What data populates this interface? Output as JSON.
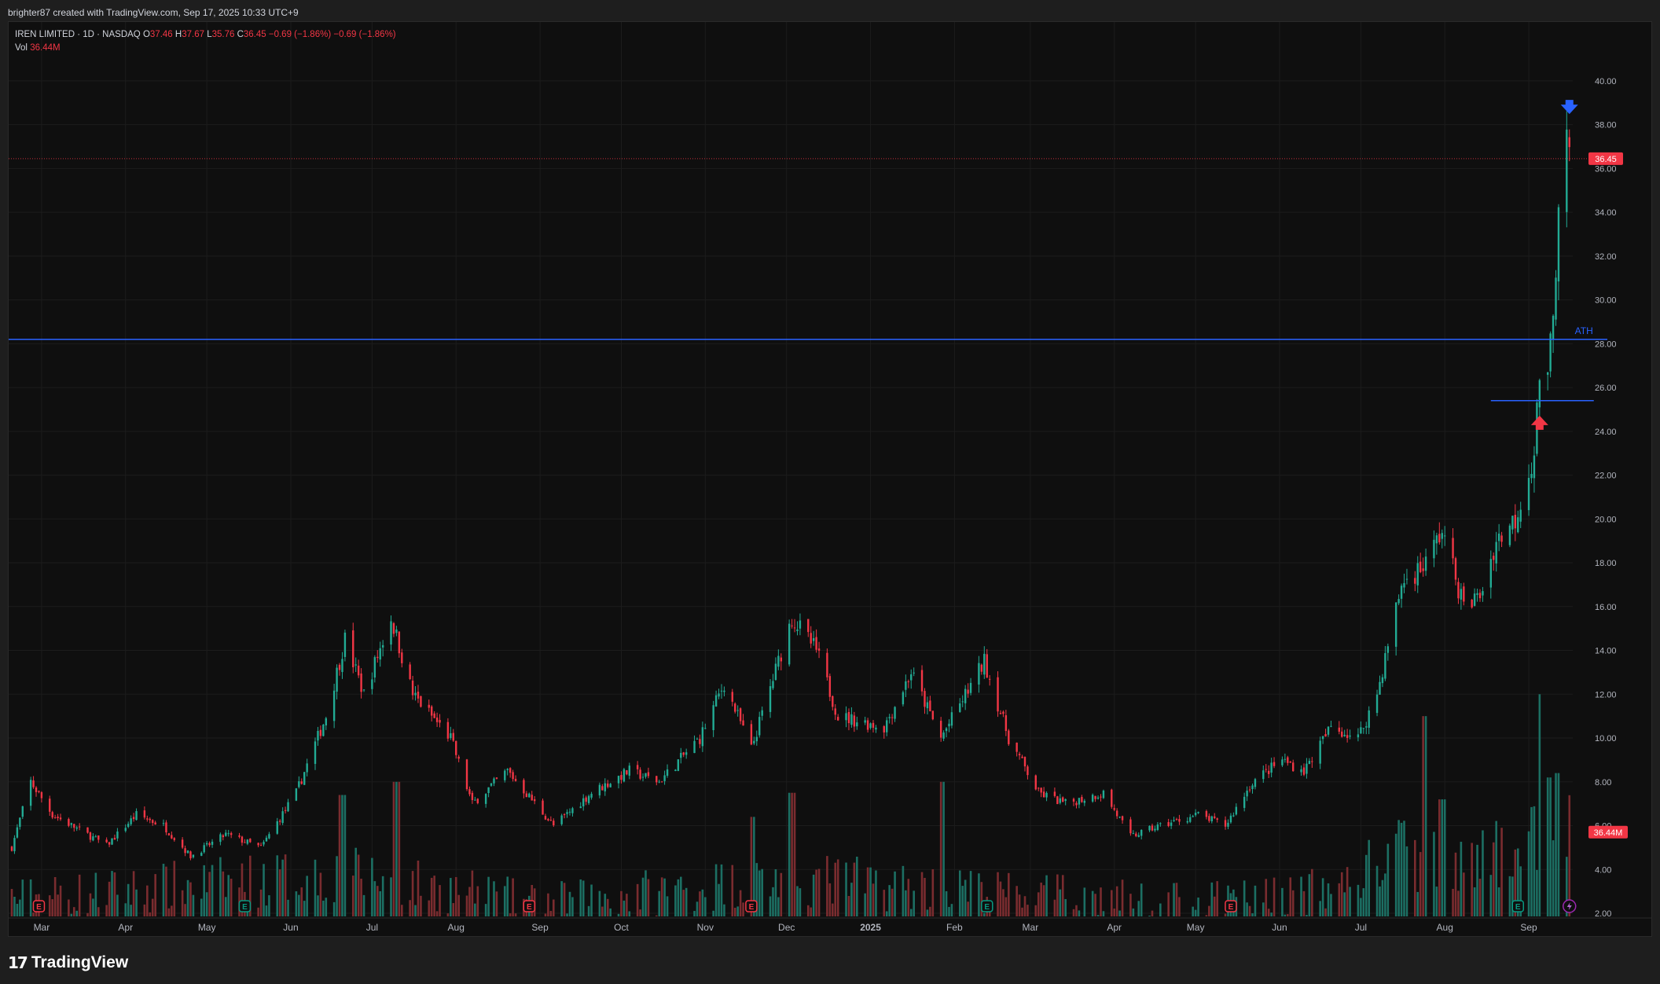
{
  "header": {
    "caption": "brighter87 created with TradingView.com, Sep 17, 2025 10:33 UTC+9"
  },
  "legend": {
    "symbol": "IREN LIMITED · 1D · NASDAQ",
    "o_label": "O",
    "o": "37.46",
    "h_label": "H",
    "h": "37.67",
    "l_label": "L",
    "l": "35.76",
    "c_label": "C",
    "c": "36.45",
    "change": "−0.69 (−1.86%)",
    "change2": "−0.69 (−1.86%)",
    "vol_label": "Vol",
    "vol": "36.44M"
  },
  "footer": {
    "logo_mark": "17",
    "logo_text": "TradingView"
  },
  "colors": {
    "up": "#22ab94",
    "down": "#f23645",
    "up_vol": "#1c6f63",
    "down_vol": "#7a2c2f",
    "level": "#2962ff",
    "grid": "#1c1c1c",
    "axis_text": "#b2b5be",
    "bg": "#0f0f0f",
    "arrow_down": "#2962ff",
    "arrow_up": "#f23645",
    "earnings": "#f23645",
    "earnings_green": "#089981"
  },
  "chart_data": {
    "type": "candlestick",
    "interval": "1D",
    "ylim": [
      2,
      41
    ],
    "y_ticks": [
      "40.00",
      "38.00",
      "36.00",
      "34.00",
      "32.00",
      "30.00",
      "28.00",
      "26.00",
      "24.00",
      "22.00",
      "20.00",
      "18.00",
      "16.00",
      "14.00",
      "12.00",
      "10.00",
      "8.00",
      "6.00",
      "4.00",
      "2.00"
    ],
    "x_ticks": [
      "Mar",
      "Apr",
      "May",
      "Jun",
      "Jul",
      "Aug",
      "Sep",
      "Oct",
      "Nov",
      "Dec",
      "2025",
      "Feb",
      "Mar",
      "Apr",
      "May",
      "Jun",
      "Jul",
      "Aug",
      "Sep"
    ],
    "x_range": [
      "2024-02-19",
      "2025-09-30"
    ],
    "last_price": {
      "value": 36.45,
      "label": "36.45"
    },
    "last_volume": {
      "value": 6.6,
      "label": "36.44M"
    },
    "ath_level": {
      "value": 28.2,
      "label": "ATH"
    },
    "support_level": {
      "value": 25.4,
      "from": "2025-08-18",
      "to": "2025-09-25"
    },
    "markers": [
      {
        "type": "arrow-down",
        "date": "2025-09-16",
        "price": 38.7
      },
      {
        "type": "arrow-up",
        "date": "2025-09-05",
        "price": 24.5
      }
    ],
    "earnings": [
      {
        "date": "2024-02-29",
        "label": "E",
        "color": "red"
      },
      {
        "date": "2024-05-15",
        "label": "E",
        "color": "green"
      },
      {
        "date": "2024-08-28",
        "label": "E",
        "color": "red"
      },
      {
        "date": "2024-11-18",
        "label": "E",
        "color": "red"
      },
      {
        "date": "2025-02-13",
        "label": "E",
        "color": "green"
      },
      {
        "date": "2025-05-14",
        "label": "E",
        "color": "red"
      },
      {
        "date": "2025-08-28",
        "label": "E",
        "color": "green"
      }
    ],
    "price_path": [
      [
        "2024-02-19",
        5.0
      ],
      [
        "2024-02-26",
        8.0
      ],
      [
        "2024-03-05",
        6.5
      ],
      [
        "2024-03-25",
        5.1
      ],
      [
        "2024-04-05",
        6.5
      ],
      [
        "2024-04-15",
        6.0
      ],
      [
        "2024-04-25",
        4.6
      ],
      [
        "2024-05-08",
        5.6
      ],
      [
        "2024-05-21",
        5.0
      ],
      [
        "2024-06-03",
        7.5
      ],
      [
        "2024-06-14",
        11.0
      ],
      [
        "2024-06-21",
        14.5
      ],
      [
        "2024-06-28",
        12.0
      ],
      [
        "2024-07-08",
        15.5
      ],
      [
        "2024-07-16",
        12.0
      ],
      [
        "2024-07-30",
        10.0
      ],
      [
        "2024-08-07",
        7.0
      ],
      [
        "2024-08-20",
        8.5
      ],
      [
        "2024-09-06",
        6.0
      ],
      [
        "2024-09-20",
        7.5
      ],
      [
        "2024-10-04",
        8.5
      ],
      [
        "2024-10-15",
        8.0
      ],
      [
        "2024-10-30",
        10.0
      ],
      [
        "2024-11-08",
        12.5
      ],
      [
        "2024-11-18",
        9.5
      ],
      [
        "2024-12-03",
        15.5
      ],
      [
        "2024-12-12",
        14.0
      ],
      [
        "2024-12-20",
        11.0
      ],
      [
        "2025-01-06",
        10.5
      ],
      [
        "2025-01-16",
        13.0
      ],
      [
        "2025-01-27",
        10.0
      ],
      [
        "2025-02-12",
        13.5
      ],
      [
        "2025-02-21",
        10.0
      ],
      [
        "2025-03-04",
        7.5
      ],
      [
        "2025-03-14",
        7.0
      ],
      [
        "2025-03-28",
        7.5
      ],
      [
        "2025-04-07",
        5.5
      ],
      [
        "2025-04-18",
        6.0
      ],
      [
        "2025-05-02",
        6.5
      ],
      [
        "2025-05-12",
        6.0
      ],
      [
        "2025-05-22",
        8.0
      ],
      [
        "2025-06-02",
        9.0
      ],
      [
        "2025-06-10",
        8.5
      ],
      [
        "2025-06-20",
        10.5
      ],
      [
        "2025-06-30",
        10.0
      ],
      [
        "2025-07-07",
        12.0
      ],
      [
        "2025-07-16",
        17.0
      ],
      [
        "2025-07-25",
        18.0
      ],
      [
        "2025-07-31",
        19.5
      ],
      [
        "2025-08-08",
        16.0
      ],
      [
        "2025-08-14",
        16.5
      ],
      [
        "2025-08-20",
        19.0
      ],
      [
        "2025-08-27",
        20.0
      ],
      [
        "2025-09-03",
        23.0
      ],
      [
        "2025-09-06",
        28.5
      ],
      [
        "2025-09-08",
        26.0
      ],
      [
        "2025-09-10",
        30.0
      ],
      [
        "2025-09-12",
        33.5
      ],
      [
        "2025-09-15",
        37.0
      ],
      [
        "2025-09-16",
        36.45
      ]
    ],
    "volume_path": [
      [
        "2024-02-19",
        2.8
      ],
      [
        "2024-06-20",
        4.0
      ],
      [
        "2024-07-10",
        3.6
      ],
      [
        "2024-09-01",
        2.6
      ],
      [
        "2024-12-01",
        3.8
      ],
      [
        "2025-03-01",
        3.0
      ],
      [
        "2025-05-01",
        2.6
      ],
      [
        "2025-06-20",
        3.2
      ],
      [
        "2025-07-15",
        5.0
      ],
      [
        "2025-08-10",
        4.2
      ],
      [
        "2025-09-05",
        5.8
      ],
      [
        "2025-09-16",
        6.2
      ]
    ],
    "volume_spikes": [
      [
        "2024-07-10",
        8.0
      ],
      [
        "2024-06-20",
        7.4
      ],
      [
        "2024-11-18",
        6.4
      ],
      [
        "2024-12-03",
        7.5
      ],
      [
        "2025-01-27",
        8.0
      ],
      [
        "2025-07-25",
        11.0
      ],
      [
        "2025-07-31",
        7.2
      ],
      [
        "2025-09-06",
        12.0
      ],
      [
        "2025-09-08",
        8.2
      ],
      [
        "2025-09-12",
        8.4
      ]
    ]
  }
}
